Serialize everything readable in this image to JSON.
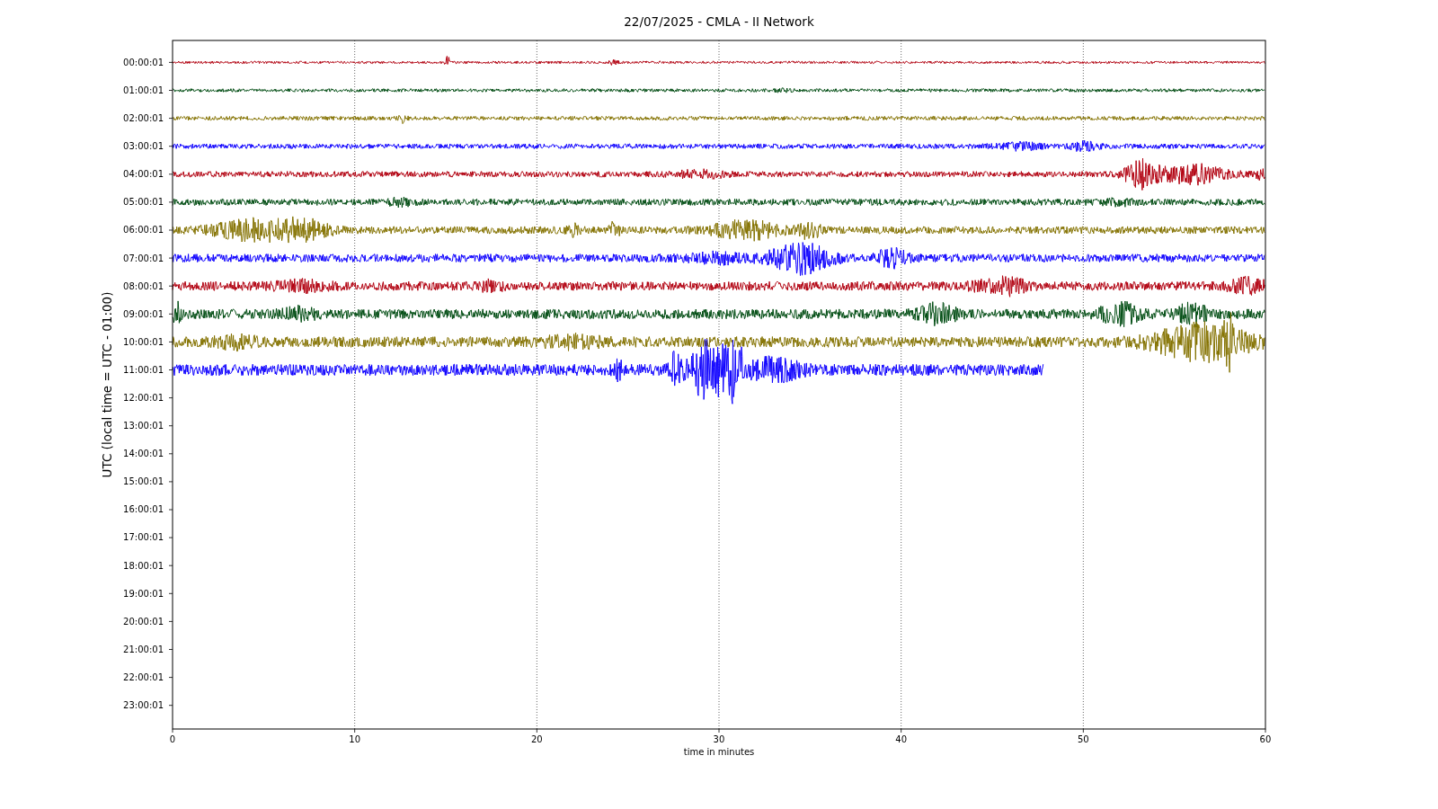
{
  "title": "22/07/2025 - CMLA - II Network",
  "ylabel": "UTC (local time = UTC - 01:00)",
  "xlabel": "time in minutes",
  "xticks": [
    "0",
    "10",
    "20",
    "30",
    "40",
    "50",
    "60"
  ],
  "yticks": [
    "00:00:01",
    "01:00:01",
    "02:00:01",
    "03:00:01",
    "04:00:01",
    "05:00:01",
    "06:00:01",
    "07:00:01",
    "08:00:01",
    "09:00:01",
    "10:00:01",
    "11:00:01",
    "12:00:01",
    "13:00:01",
    "14:00:01",
    "15:00:01",
    "16:00:01",
    "17:00:01",
    "18:00:01",
    "19:00:01",
    "20:00:01",
    "21:00:01",
    "22:00:01",
    "23:00:01"
  ],
  "traces": [
    {
      "color": "#b2000f",
      "level": 1
    },
    {
      "color": "#004c12",
      "level": 1
    },
    {
      "color": "#847200",
      "level": 1
    },
    {
      "color": "#0e01ff",
      "level": 1
    },
    {
      "color": "#b2000f",
      "level": 1
    },
    {
      "color": "#004c12",
      "level": 1
    },
    {
      "color": "#847200",
      "level": 1
    },
    {
      "color": "#0e01ff",
      "level": 1
    },
    {
      "color": "#b2000f",
      "level": 1
    },
    {
      "color": "#004c12",
      "level": 1
    },
    {
      "color": "#847200",
      "level": 1
    },
    {
      "color": "#0e01ff",
      "level": 0.797
    }
  ]
}
